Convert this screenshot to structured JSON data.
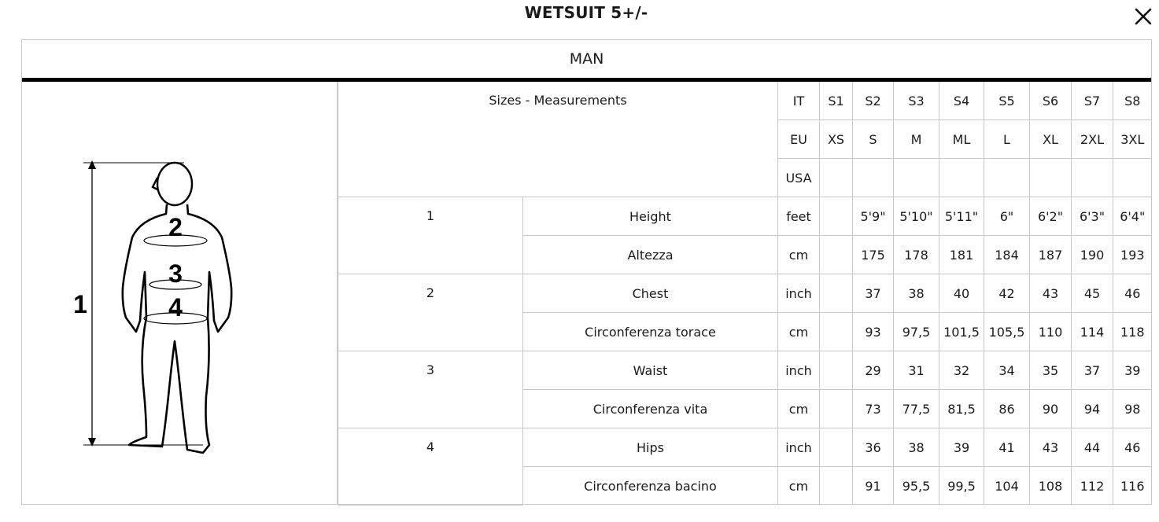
{
  "modal": {
    "title": "WETSUIT 5+/-",
    "close_icon": "close-icon"
  },
  "section": {
    "gender": "MAN"
  },
  "diagram": {
    "labels": [
      "1",
      "2",
      "3",
      "4"
    ]
  },
  "table": {
    "header_label": "Sizes - Measurements",
    "size_systems": [
      {
        "system": "IT",
        "sizes": [
          "S1",
          "S2",
          "S3",
          "S4",
          "S5",
          "S6",
          "S7",
          "S8"
        ]
      },
      {
        "system": "EU",
        "sizes": [
          "XS",
          "S",
          "M",
          "ML",
          "L",
          "XL",
          "2XL",
          "3XL"
        ]
      },
      {
        "system": "USA",
        "sizes": [
          "",
          "",
          "",
          "",
          "",
          "",
          "",
          ""
        ]
      }
    ],
    "groups": [
      {
        "number": "1",
        "rows": [
          {
            "name": "Height",
            "unit": "feet",
            "values": [
              "",
              "5'9\"",
              "5'10\"",
              "5'11\"",
              "6\"",
              "6'2\"",
              "6'3\"",
              "6'4\""
            ]
          },
          {
            "name": "Altezza",
            "unit": "cm",
            "values": [
              "",
              "175",
              "178",
              "181",
              "184",
              "187",
              "190",
              "193"
            ]
          }
        ]
      },
      {
        "number": "2",
        "rows": [
          {
            "name": "Chest",
            "unit": "inch",
            "values": [
              "",
              "37",
              "38",
              "40",
              "42",
              "43",
              "45",
              "46"
            ]
          },
          {
            "name": "Circonferenza torace",
            "unit": "cm",
            "values": [
              "",
              "93",
              "97,5",
              "101,5",
              "105,5",
              "110",
              "114",
              "118"
            ]
          }
        ]
      },
      {
        "number": "3",
        "rows": [
          {
            "name": "Waist",
            "unit": "inch",
            "values": [
              "",
              "29",
              "31",
              "32",
              "34",
              "35",
              "37",
              "39"
            ]
          },
          {
            "name": "Circonferenza vita",
            "unit": "cm",
            "values": [
              "",
              "73",
              "77,5",
              "81,5",
              "86",
              "90",
              "94",
              "98"
            ]
          }
        ]
      },
      {
        "number": "4",
        "rows": [
          {
            "name": "Hips",
            "unit": "inch",
            "values": [
              "",
              "36",
              "38",
              "39",
              "41",
              "43",
              "44",
              "46"
            ]
          },
          {
            "name": "Circonferenza bacino",
            "unit": "cm",
            "values": [
              "",
              "91",
              "95,5",
              "99,5",
              "104",
              "108",
              "112",
              "116"
            ]
          }
        ]
      }
    ]
  }
}
